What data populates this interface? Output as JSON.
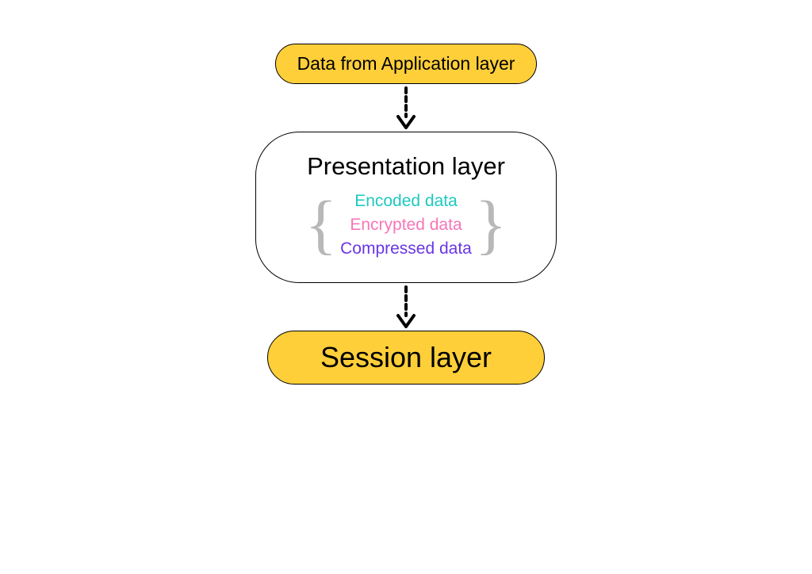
{
  "topBox": {
    "label": "Data from Application layer"
  },
  "middleBox": {
    "title": "Presentation layer",
    "items": {
      "encoded": "Encoded data",
      "encrypted": "Encrypted data",
      "compressed": "Compressed data"
    }
  },
  "bottomBox": {
    "label": "Session layer"
  },
  "braces": {
    "left": "{",
    "right": "}"
  }
}
